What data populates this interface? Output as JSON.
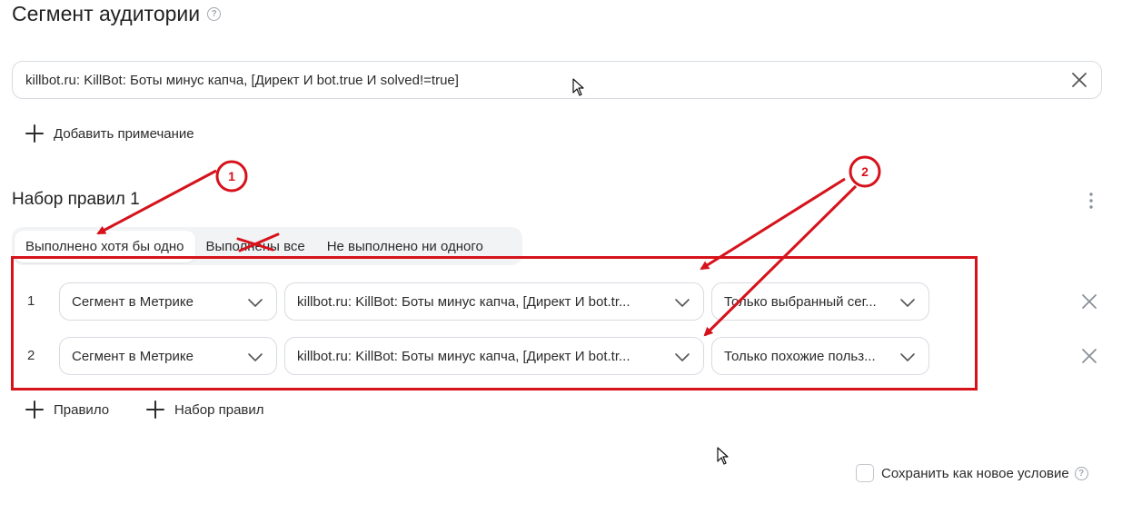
{
  "header": {
    "title": "Сегмент аудитории",
    "help_icon": "question-circle-icon"
  },
  "segment_field": {
    "value": "killbot.ru: KillBot: Боты минус капча, [Директ И bot.true И solved!=true]",
    "clear_icon": "close-icon"
  },
  "add_note": {
    "label": "Добавить примечание",
    "icon": "plus-icon"
  },
  "ruleset": {
    "title": "Набор правил 1",
    "menu_icon": "kebab-menu-icon",
    "tabs": [
      {
        "label": "Выполнено хотя бы одно",
        "active": true
      },
      {
        "label": "Выполнены все",
        "active": false
      },
      {
        "label": "Не выполнено ни одного",
        "active": false
      }
    ],
    "rules": [
      {
        "num": "1",
        "type": "Сегмент в Метрике",
        "segment": "killbot.ru: KillBot: Боты минус капча, [Директ И bot.tr...",
        "mode": "Только выбранный сег..."
      },
      {
        "num": "2",
        "type": "Сегмент в Метрике",
        "segment": "killbot.ru: KillBot: Боты минус капча, [Директ И bot.tr...",
        "mode": "Только похожие польз..."
      }
    ]
  },
  "actions": {
    "add_rule": "Правило",
    "add_ruleset": "Набор правил"
  },
  "save_condition": {
    "label": "Сохранить как новое условие",
    "checked": false
  },
  "annotations": {
    "badge1": "1",
    "badge2": "2",
    "color": "#d6121b"
  }
}
